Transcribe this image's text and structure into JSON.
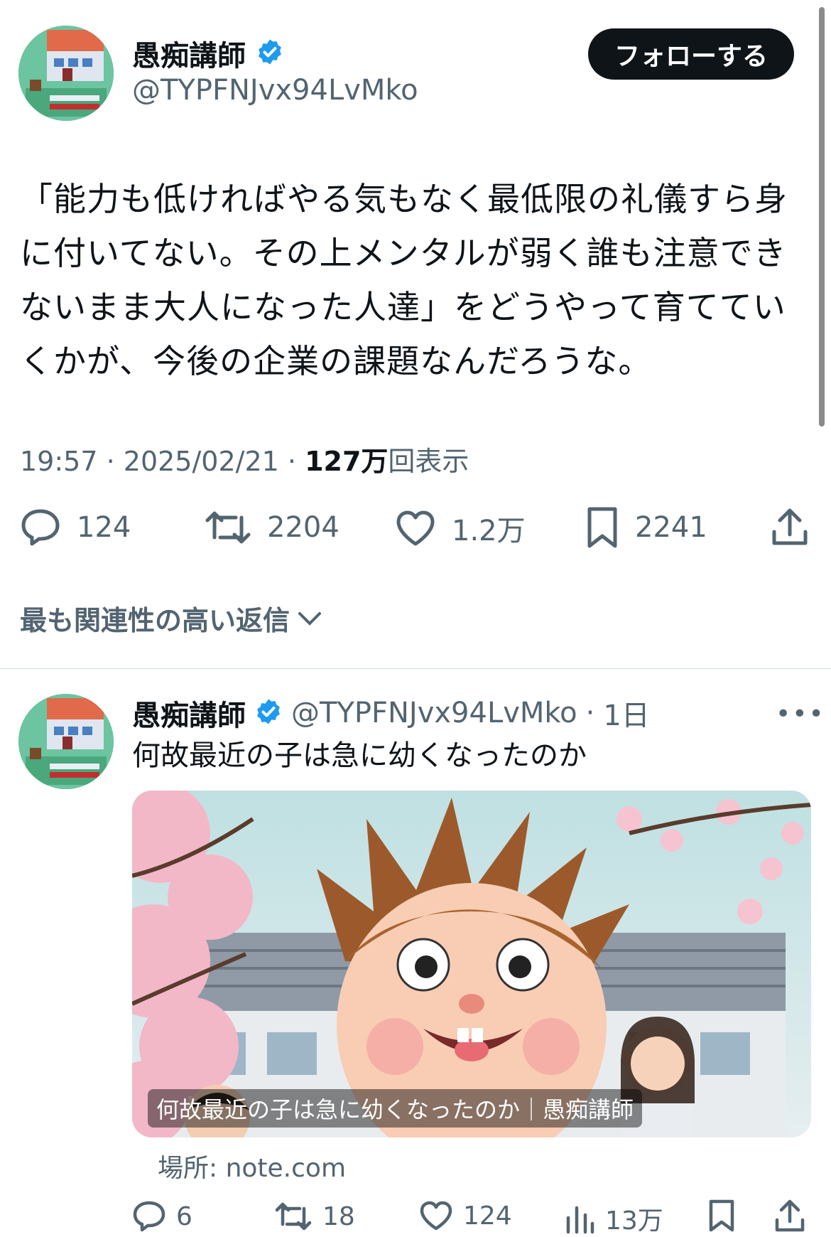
{
  "tweet": {
    "author_name": "愚痴講師",
    "author_handle": "@TYPFNJvx94LvMko",
    "follow_label": "フォローする",
    "text": "「能力も低ければやる気もなく最低限の礼儀すら身に付いてない。その上メンタルが弱く誰も注意できないまま大人になった人達」をどうやって育てていくかが、今後の企業の課題なんだろうな。",
    "time": "19:57",
    "date": "2025/02/21",
    "views_count": "127万",
    "views_label": "回表示",
    "replies": "124",
    "retweets": "2204",
    "likes": "1.2万",
    "bookmarks": "2241"
  },
  "sort_label": "最も関連性の高い返信",
  "reply": {
    "author_name": "愚痴講師",
    "author_handle": "@TYPFNJvx94LvMko",
    "age": "1日",
    "text": "何故最近の子は急に幼くなったのか",
    "card_caption": "何故最近の子は急に幼くなったのか｜愚痴講師",
    "source": "場所: note.com",
    "replies": "6",
    "retweets": "18",
    "likes": "124",
    "views": "13万"
  },
  "icons": [
    "verified-badge-icon",
    "reply-icon",
    "retweet-icon",
    "like-icon",
    "bookmark-icon",
    "share-icon",
    "chevron-down-icon",
    "more-icon",
    "views-icon"
  ],
  "colors": {
    "verified": "#1d9bf0",
    "text": "#0f1419",
    "muted": "#536471",
    "button": "#0f1419"
  }
}
